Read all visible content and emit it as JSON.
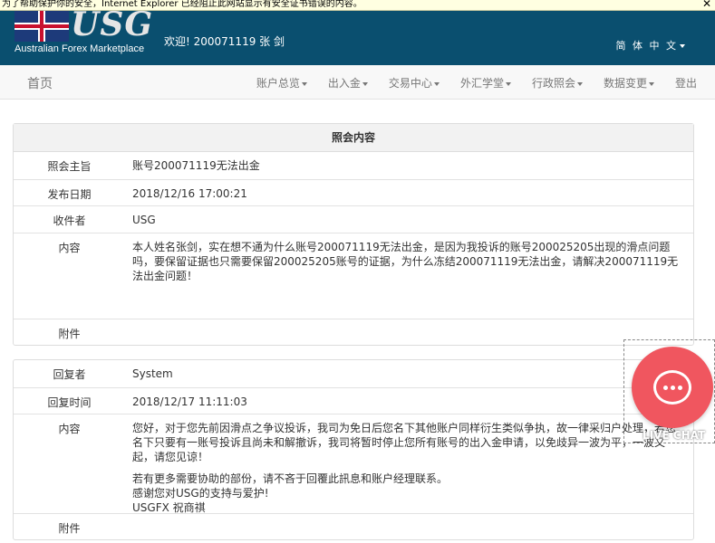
{
  "ie_bar": {
    "text": "为了帮助保护你的安全，Internet Explorer 已经阻止此网站显示有安全证书错误的内容。",
    "close": "✕"
  },
  "header": {
    "logo_text": "USG",
    "tagline": "Australian Forex Marketplace",
    "welcome": "欢迎! 200071119 张 剑",
    "language": "简 体 中 文"
  },
  "nav": {
    "home": "首页",
    "items": [
      "账户总览",
      "出入金",
      "交易中心",
      "外汇学堂",
      "行政照会",
      "数据变更",
      "登出"
    ]
  },
  "notice": {
    "title": "照会内容",
    "rows": [
      {
        "label": "照会主旨",
        "value": "账号200071119无法出金"
      },
      {
        "label": "发布日期",
        "value": "2018/12/16 17:00:21"
      },
      {
        "label": "收件者",
        "value": "USG"
      },
      {
        "label": "内容",
        "value": "本人姓名张剑，实在想不通为什么账号200071119无法出金，是因为我投诉的账号200025205出现的滑点问题吗，要保留证据也只需要保留200025205账号的证据，为什么冻结200071119无法出金，请解决200071119无法出金问题！"
      },
      {
        "label": "附件",
        "value": ""
      }
    ]
  },
  "reply": {
    "rows": [
      {
        "label": "回复者",
        "value": "System"
      },
      {
        "label": "回复时间",
        "value": "2018/12/17 11:11:03"
      },
      {
        "label": "内容",
        "paragraphs": [
          "您好，对于您先前因滑点之争议投诉，我司为免日后您名下其他账户同样衍生类似争执，故一律采归户处理，若您名下只要有一账号投诉且尚未和解撤诉，我司将暂时停止您所有账号的出入金申请，以免歧异一波为平，一波又起，请您见谅！",
          "若有更多需要协助的部份，请不吝于回覆此訊息和账户经理联系。",
          "感谢您对USG的支持与爱护!",
          "USGFX 祝商祺"
        ]
      },
      {
        "label": "附件",
        "value": ""
      }
    ]
  },
  "live_chat": {
    "label": "LIVE CHAT",
    "icon": "chat-bubble-icon"
  }
}
